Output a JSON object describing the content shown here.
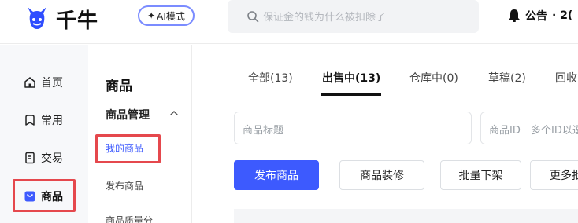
{
  "header": {
    "brand": "千牛",
    "ai_button": "AI模式",
    "search_placeholder": "保证金的钱为什么被扣除了",
    "notice_label": "公告",
    "notice_extra": "· 2("
  },
  "left_nav": {
    "items": [
      {
        "label": "首页",
        "icon": "home-icon"
      },
      {
        "label": "常用",
        "icon": "bookmark-icon"
      },
      {
        "label": "交易",
        "icon": "document-icon"
      },
      {
        "label": "商品",
        "icon": "product-icon",
        "active": true
      }
    ]
  },
  "sub_nav": {
    "title": "商品",
    "group": "商品管理",
    "items": [
      {
        "label": "我的商品",
        "active": true
      },
      {
        "label": "发布商品"
      },
      {
        "label": "商品质量分"
      }
    ]
  },
  "tabs": [
    {
      "label": "全部(13)"
    },
    {
      "label": "出售中(13)",
      "active": true
    },
    {
      "label": "仓库中(0)"
    },
    {
      "label": "草稿(2)"
    },
    {
      "label": "回收"
    }
  ],
  "filters": {
    "title_placeholder": "商品标题",
    "id_label": "商品ID",
    "id_placeholder": "多个ID以逗"
  },
  "actions": {
    "publish": "发布商品",
    "decorate": "商品装修",
    "batch_offline": "批量下架",
    "more": "更多批"
  },
  "colors": {
    "accent": "#3d5afe",
    "highlight_box": "#e5484d"
  }
}
